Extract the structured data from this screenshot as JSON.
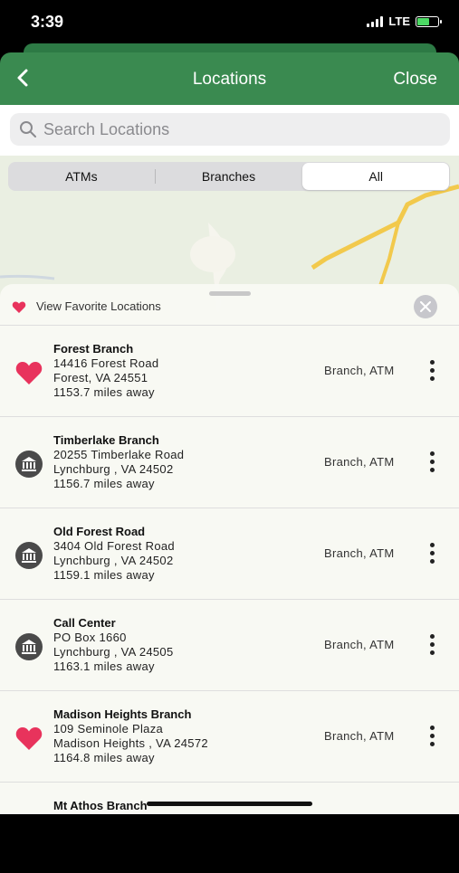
{
  "status": {
    "time": "3:39",
    "network": "LTE"
  },
  "nav": {
    "title": "Locations",
    "close_label": "Close"
  },
  "search": {
    "placeholder": "Search Locations"
  },
  "segments": [
    {
      "label": "ATMs",
      "selected": false
    },
    {
      "label": "Branches",
      "selected": false
    },
    {
      "label": "All",
      "selected": true
    }
  ],
  "favorites": {
    "label": "View Favorite Locations"
  },
  "locations": [
    {
      "name": "Forest Branch",
      "address": "14416 Forest Road",
      "city": "Forest, VA  24551",
      "distance": "1153.7 miles away",
      "type": "Branch, ATM",
      "icon": "heart-icon"
    },
    {
      "name": "Timberlake Branch",
      "address": "20255 Timberlake Road",
      "city": "Lynchburg , VA  24502",
      "distance": "1156.7 miles away",
      "type": "Branch, ATM",
      "icon": "bank-icon"
    },
    {
      "name": "Old Forest Road",
      "address": "3404 Old Forest Road",
      "city": "Lynchburg , VA  24502",
      "distance": "1159.1 miles away",
      "type": "Branch, ATM",
      "icon": "bank-icon"
    },
    {
      "name": "Call Center",
      "address": "PO Box 1660",
      "city": "Lynchburg , VA  24505",
      "distance": "1163.1 miles away",
      "type": "Branch, ATM",
      "icon": "bank-icon"
    },
    {
      "name": "Madison Heights Branch",
      "address": "109 Seminole Plaza",
      "city": "Madison Heights , VA  24572",
      "distance": "1164.8 miles away",
      "type": "Branch, ATM",
      "icon": "heart-icon"
    },
    {
      "name": "Mt Athos Branch",
      "address": "",
      "city": "",
      "distance": "",
      "type": "",
      "icon": ""
    }
  ],
  "colors": {
    "header_green": "#3a8a50",
    "favorite_pink": "#e8335c",
    "road_yellow": "#f2c94c"
  }
}
